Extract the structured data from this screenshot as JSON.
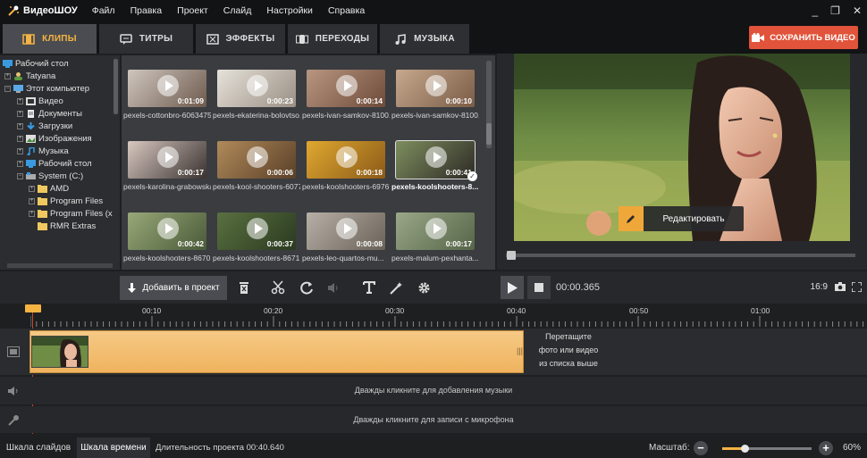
{
  "app": {
    "name": "ВидеоШОУ"
  },
  "menu": [
    "Файл",
    "Правка",
    "Проект",
    "Слайд",
    "Настройки",
    "Справка"
  ],
  "window_controls": {
    "minimize": "_",
    "restore": "❐",
    "close": "✕"
  },
  "tabs": [
    {
      "label": "КЛИПЫ",
      "icon": "film-icon",
      "active": true
    },
    {
      "label": "ТИТРЫ",
      "icon": "titles-icon",
      "active": false
    },
    {
      "label": "ЭФФЕКТЫ",
      "icon": "effects-icon",
      "active": false
    },
    {
      "label": "ПЕРЕХОДЫ",
      "icon": "transitions-icon",
      "active": false
    },
    {
      "label": "МУЗЫКА",
      "icon": "music-icon",
      "active": false
    }
  ],
  "save_button": {
    "label": "СОХРАНИТЬ ВИДЕО",
    "color": "#e1533a"
  },
  "tree": [
    {
      "label": "Рабочий стол",
      "icon": "desktop-icon",
      "level": 0
    },
    {
      "label": "Tatyana",
      "icon": "user-icon",
      "level": 1
    },
    {
      "label": "Этот компьютер",
      "icon": "computer-icon",
      "level": 1
    },
    {
      "label": "Видео",
      "icon": "video-folder-icon",
      "level": 2
    },
    {
      "label": "Документы",
      "icon": "documents-icon",
      "level": 2
    },
    {
      "label": "Загрузки",
      "icon": "downloads-icon",
      "level": 2
    },
    {
      "label": "Изображения",
      "icon": "images-icon",
      "level": 2
    },
    {
      "label": "Музыка",
      "icon": "music-folder-icon",
      "level": 2
    },
    {
      "label": "Рабочий стол",
      "icon": "desktop-icon",
      "level": 2
    },
    {
      "label": "System (C:)",
      "icon": "drive-icon",
      "level": 2
    },
    {
      "label": "AMD",
      "icon": "folder-icon",
      "level": 3
    },
    {
      "label": "Program Files",
      "icon": "folder-icon",
      "level": 3
    },
    {
      "label": "Program Files (x",
      "icon": "folder-icon",
      "level": 3
    },
    {
      "label": "RMR Extras",
      "icon": "folder-icon",
      "level": 3
    }
  ],
  "clips": [
    {
      "name": "pexels-cottonbro-6063475...",
      "duration": "0:01:09",
      "colors": [
        "#cfc6bf",
        "#6e5a4d"
      ]
    },
    {
      "name": "pexels-ekaterina-bolovtso...",
      "duration": "0:00:23",
      "colors": [
        "#e6e2da",
        "#9a8f84"
      ]
    },
    {
      "name": "pexels-ivan-samkov-8100...",
      "duration": "0:00:14",
      "colors": [
        "#b89680",
        "#6e4b3a"
      ]
    },
    {
      "name": "pexels-ivan-samkov-8100...",
      "duration": "0:00:10",
      "colors": [
        "#c6a88e",
        "#7a5c46"
      ]
    },
    {
      "name": "pexels-karolina-grabowska...",
      "duration": "0:00:17",
      "colors": [
        "#d8c8c0",
        "#3a3230"
      ]
    },
    {
      "name": "pexels-kool-shooters-6077...",
      "duration": "0:00:06",
      "colors": [
        "#b08a5a",
        "#5a4028"
      ]
    },
    {
      "name": "pexels-koolshooters-6976...",
      "duration": "0:00:18",
      "colors": [
        "#e0a830",
        "#8a5a18"
      ]
    },
    {
      "name": "pexels-koolshooters-8...",
      "duration": "0:00:41",
      "colors": [
        "#7d8e5e",
        "#2e2a26"
      ],
      "selected": true
    },
    {
      "name": "pexels-koolshooters-8670...",
      "duration": "0:00:42",
      "colors": [
        "#98a878",
        "#4a5a38"
      ]
    },
    {
      "name": "pexels-koolshooters-8671...",
      "duration": "0:00:37",
      "colors": [
        "#5a7040",
        "#2a3a20"
      ]
    },
    {
      "name": "pexels-leo-quartos-mu...",
      "duration": "0:00:08",
      "colors": [
        "#b8b0a6",
        "#6a6258"
      ]
    },
    {
      "name": "pexels-malum-pexhanta...",
      "duration": "0:00:17",
      "colors": [
        "#9aa888",
        "#566448"
      ]
    }
  ],
  "preview": {
    "edit_label": "Редактировать",
    "timecode": "00:00.365",
    "ratio": "16:9",
    "progress": 0.01
  },
  "toolbar": {
    "add_label": "Добавить в проект"
  },
  "ruler": {
    "labels": [
      "00:10",
      "00:20",
      "00:30",
      "00:40",
      "00:50",
      "01:00"
    ]
  },
  "timeline": {
    "drop_hint": "Перетащите фото или видео из списка выше",
    "drop_hint_lines": [
      "Перетащите",
      "фото или видео",
      "из списка выше"
    ],
    "music_hint": "Дважды кликните для добавления музыки",
    "mic_hint": "Дважды кликните для записи с микрофона"
  },
  "status": {
    "slides_tab": "Шкала слайдов",
    "timeline_tab": "Шкала времени",
    "duration": "Длительность проекта 00:40.640",
    "zoom_label": "Масштаб:",
    "zoom_percent": "60%",
    "zoom_level": 0.25
  },
  "accent": "#f5b342"
}
